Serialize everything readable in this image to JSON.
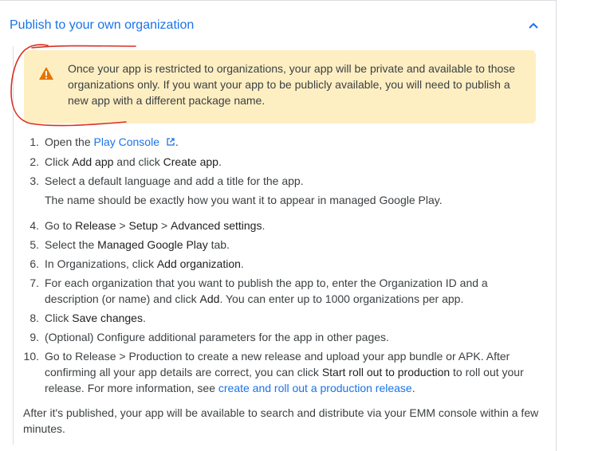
{
  "section": {
    "title": "Publish to your own organization"
  },
  "warning": {
    "text": "Once your app is restricted to organizations, your app will be private and available to those organizations only. If you want your app to be publicly available, you will need to publish a new app with a different package name."
  },
  "steps": [
    {
      "num": "1.",
      "p1": "Open the ",
      "link": "Play Console",
      "p2": "."
    },
    {
      "num": "2.",
      "p1": "Click ",
      "b1": "Add app",
      "p2": " and click ",
      "b2": "Create app",
      "p3": "."
    },
    {
      "num": "3.",
      "p1": "Select a default language and add a title for the app.",
      "sub": "The name should be exactly how you want it to appear in managed Google Play."
    },
    {
      "num": "4.",
      "p1": "Go to ",
      "b1": "Release",
      "p2": " > ",
      "b2": "Setup",
      "p3": " > ",
      "b3": "Advanced settings",
      "p4": "."
    },
    {
      "num": "5.",
      "p1": "Select the ",
      "b1": "Managed Google Play",
      "p2": " tab."
    },
    {
      "num": "6.",
      "p1": "In Organizations, click ",
      "b1": "Add organization",
      "p2": "."
    },
    {
      "num": "7.",
      "p1": "For each organization that you want to publish the app to, enter the Organization ID and a description (or name) and click ",
      "b1": "Add",
      "p2": ". You can enter up to 1000 organizations per app."
    },
    {
      "num": "8.",
      "p1": "Click ",
      "b1": "Save changes",
      "p2": "."
    },
    {
      "num": "9.",
      "p1": "(Optional) Configure additional parameters for the app in other pages."
    },
    {
      "num": "10.",
      "p1": "Go to Release > Production to create a new release and upload your app bundle or APK. After confirming all your app details are correct, you can click ",
      "b1": "Start roll out to production",
      "p2": " to roll out your release. For more information, see ",
      "link": "create and roll out a production release",
      "p3": "."
    }
  ],
  "footer": {
    "text": "After it's published, your app will be available to search and distribute via your EMM console within a few minutes."
  },
  "colors": {
    "link": "#1a73e8",
    "warning_bg": "#feefc3",
    "warning_icon": "#e37400",
    "annotation": "#d93025"
  },
  "icons": {
    "collapse": "chevron-up-icon",
    "warning": "warning-triangle-icon",
    "external": "external-link-icon"
  }
}
